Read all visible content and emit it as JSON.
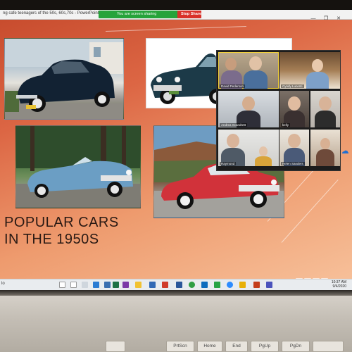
{
  "window": {
    "doc_title": "ng cafe teenagers of the 50s, 60s,70s - PowerPoint",
    "share_text": "You are screen sharing",
    "stop_share": "Stop Share",
    "controls": [
      "—",
      "❐",
      "✕"
    ]
  },
  "slide": {
    "title_line1": "POPULAR CARS",
    "title_line2": "IN THE 1950S"
  },
  "zoom": {
    "participants": [
      {
        "name": "David Pederson",
        "active": true
      },
      {
        "name": "Cyndy Lucenti"
      },
      {
        "name": "Andrea Scandrett"
      },
      {
        "name": "kelly"
      },
      {
        "name": ""
      },
      {
        "name": "Raymond"
      },
      {
        "name": ""
      },
      {
        "name": "Helen Sanders"
      }
    ]
  },
  "taskbar": {
    "left_label": "lo",
    "time": "10:37 AM",
    "date": "9/4/2020",
    "icons": [
      "windows-icon",
      "search-icon",
      "task-view-icon",
      "edge-icon",
      "store-icon",
      "excel-icon",
      "onenote-icon",
      "folder-icon",
      "mail-icon",
      "photos-icon",
      "word-icon",
      "chrome-icon",
      "outlook-icon",
      "onedrive-icon",
      "zoom-icon",
      "star-icon",
      "powerpoint-icon",
      "teams-icon"
    ]
  },
  "keyboard": {
    "keys": [
      "",
      "PrtScn",
      "Home",
      "End",
      "PgUp",
      "PgDn",
      ""
    ]
  },
  "colors": {
    "slide_accent": "#c64a2c",
    "share_green": "#26a33a",
    "stop_red": "#d9302a",
    "active_speaker": "#f3d23a"
  }
}
